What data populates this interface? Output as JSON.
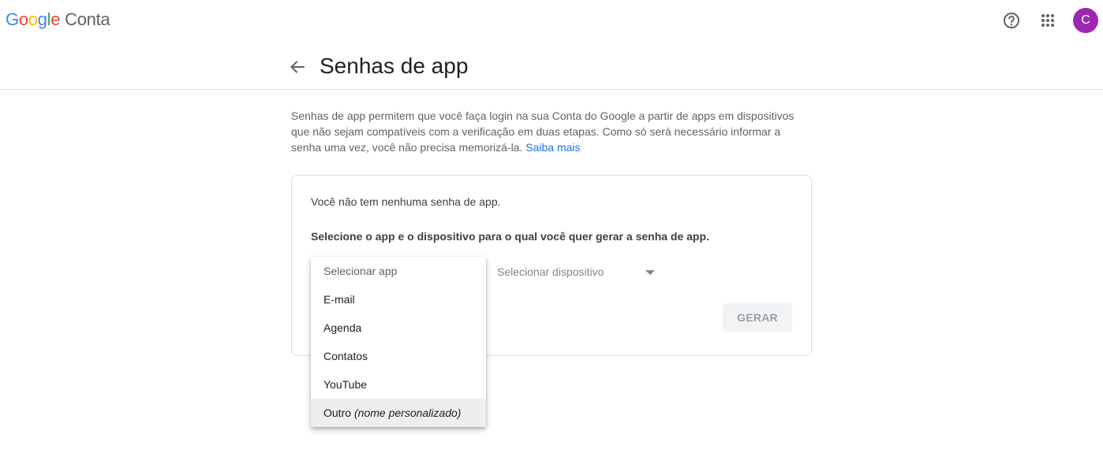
{
  "topbar": {
    "logo_letters": [
      "G",
      "o",
      "o",
      "g",
      "l",
      "e"
    ],
    "product": "Conta",
    "avatar_initial": "C",
    "icons": [
      "help-icon",
      "apps-grid-icon"
    ]
  },
  "header": {
    "title": "Senhas de app",
    "back_icon": "arrow-back-icon"
  },
  "intro": {
    "text": "Senhas de app permitem que você faça login na sua Conta do Google a partir de apps em dispositivos que não sejam compatíveis com a verificação em duas etapas. Como só será necessário informar a senha uma vez, você não precisa memorizá-la.",
    "learn_more": "Saiba mais"
  },
  "card": {
    "empty_message": "Você não tem nenhuma senha de app.",
    "instruction": "Selecione o app e o dispositivo para o qual você quer gerar a senha de app.",
    "device_placeholder": "Selecionar dispositivo",
    "generate_button": "GERAR"
  },
  "app_menu": {
    "placeholder": "Selecionar app",
    "items": [
      {
        "label": "E-mail"
      },
      {
        "label": "Agenda"
      },
      {
        "label": "Contatos"
      },
      {
        "label": "YouTube"
      },
      {
        "label": "Outro",
        "note": "(nome personalizado)"
      }
    ],
    "highlighted_index": 4
  },
  "colors": {
    "link": "#1a73e8",
    "avatar": "#9c27b0",
    "divider": "#dadce0",
    "highlight": "#eeeeee"
  }
}
